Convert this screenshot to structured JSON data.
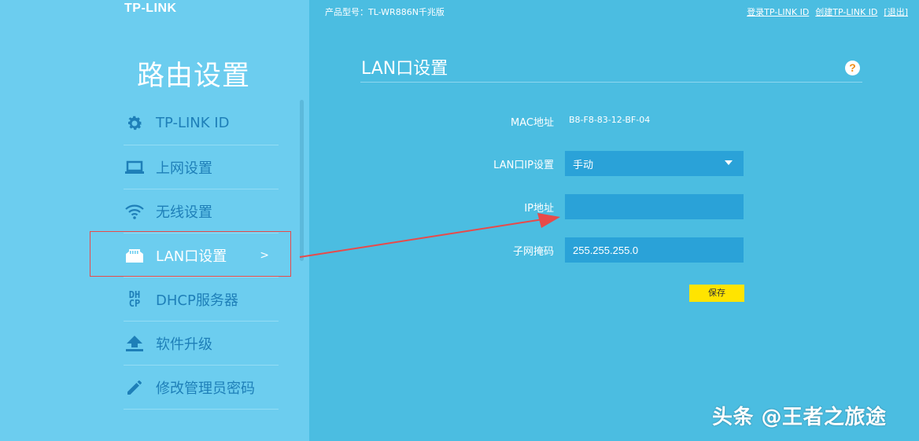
{
  "brand": {
    "logo": "TP-LINK"
  },
  "sidebar": {
    "title": "路由设置",
    "items": [
      {
        "label": "TP-LINK ID",
        "icon": "gear-icon"
      },
      {
        "label": "上网设置",
        "icon": "laptop-icon"
      },
      {
        "label": "无线设置",
        "icon": "wifi-icon"
      },
      {
        "label": "LAN口设置",
        "icon": "lan-port-icon",
        "active": true,
        "arrow": ">"
      },
      {
        "label": "DHCP服务器",
        "icon": "dhcp-icon",
        "icon_text": "DHCP"
      },
      {
        "label": "软件升级",
        "icon": "upload-icon"
      },
      {
        "label": "修改管理员密码",
        "icon": "pencil-icon"
      }
    ]
  },
  "header": {
    "model": "产品型号：TL-WR886N千兆版",
    "links": {
      "login": "登录TP-LINK ID",
      "create": "创建TP-LINK ID",
      "logout": "[退出]"
    }
  },
  "page": {
    "title": "LAN口设置",
    "help": "?",
    "mac_label": "MAC地址",
    "mac_value": "B8-F8-83-12-BF-04",
    "lan_ip_label": "LAN口IP设置",
    "lan_ip_mode": "手动",
    "ip_label": "IP地址",
    "ip_value": "",
    "subnet_label": "子网掩码",
    "subnet_value": "255.255.255.0",
    "save_label": "保存"
  },
  "watermark": "头条 @王者之旅途",
  "colors": {
    "sidebar_bg": "#6ccdef",
    "main_bg": "#4bbde1",
    "field_bg": "#2aa2d8",
    "save_button": "#ffe400",
    "annotation_red": "#e84a4a",
    "menu_text": "#1e7fb8"
  }
}
